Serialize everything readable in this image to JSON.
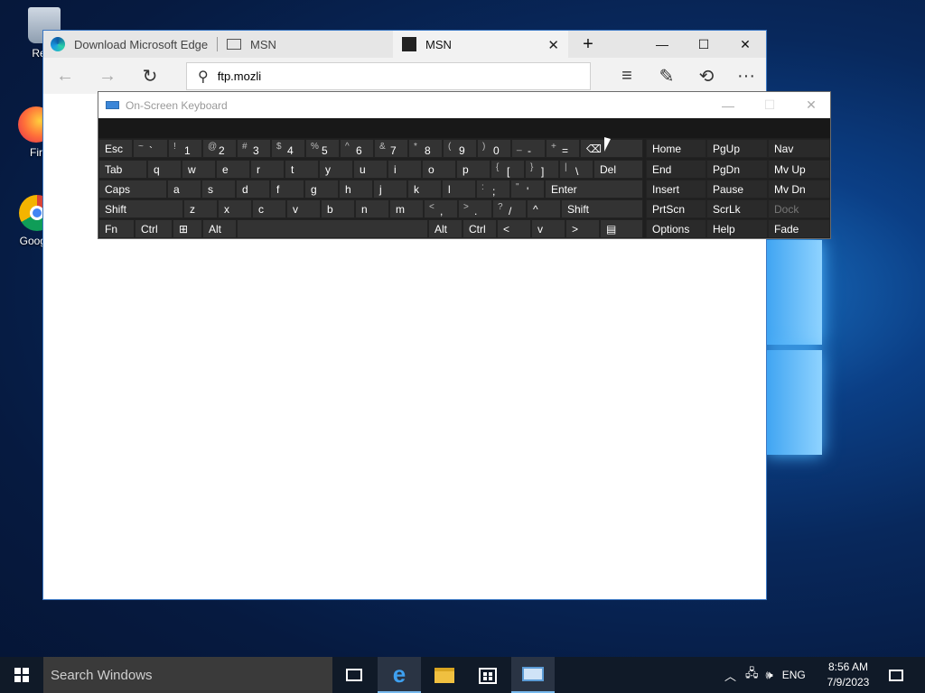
{
  "desktop": {
    "icons": [
      {
        "label": "Recy",
        "icon": "recycle-bin-icon"
      },
      {
        "label": "Fir",
        "icon": "firefox-icon"
      },
      {
        "label": "Google",
        "icon": "chrome-icon"
      }
    ]
  },
  "browser": {
    "tabs": [
      {
        "label": "Download Microsoft Edge",
        "icon": "edge-icon"
      },
      {
        "label": "MSN",
        "icon": "page-icon"
      },
      {
        "label": "MSN",
        "icon": "msn-icon",
        "active": true
      }
    ],
    "new_tab": "+",
    "window_controls": {
      "minimize": "—",
      "maximize": "☐",
      "close": "✕"
    },
    "toolbar": {
      "back": "←",
      "forward": "→",
      "refresh": "↻",
      "hub": "≡",
      "notes": "✎",
      "share": "⟲",
      "more": "···"
    },
    "address": {
      "value": "ftp.mozli",
      "search_icon": "⚲"
    }
  },
  "osk": {
    "title": "On-Screen Keyboard",
    "controls": {
      "minimize": "—",
      "maximize": "☐",
      "close": "✕"
    },
    "rows": [
      [
        {
          "m": "Esc"
        },
        {
          "s": "~",
          "m": "`"
        },
        {
          "s": "!",
          "m": "1"
        },
        {
          "s": "@",
          "m": "2"
        },
        {
          "s": "#",
          "m": "3"
        },
        {
          "s": "$",
          "m": "4"
        },
        {
          "s": "%",
          "m": "5"
        },
        {
          "s": "^",
          "m": "6"
        },
        {
          "s": "&",
          "m": "7"
        },
        {
          "s": "*",
          "m": "8"
        },
        {
          "s": "(",
          "m": "9"
        },
        {
          "s": ")",
          "m": "0"
        },
        {
          "s": "_",
          "m": "-"
        },
        {
          "s": "+",
          "m": "="
        },
        {
          "m": "⌫"
        }
      ],
      [
        {
          "m": "Tab"
        },
        {
          "m": "q"
        },
        {
          "m": "w"
        },
        {
          "m": "e"
        },
        {
          "m": "r"
        },
        {
          "m": "t"
        },
        {
          "m": "y"
        },
        {
          "m": "u"
        },
        {
          "m": "i"
        },
        {
          "m": "o"
        },
        {
          "m": "p"
        },
        {
          "s": "{",
          "m": "["
        },
        {
          "s": "}",
          "m": "]"
        },
        {
          "s": "|",
          "m": "\\"
        },
        {
          "m": "Del"
        }
      ],
      [
        {
          "m": "Caps"
        },
        {
          "m": "a"
        },
        {
          "m": "s"
        },
        {
          "m": "d"
        },
        {
          "m": "f"
        },
        {
          "m": "g"
        },
        {
          "m": "h"
        },
        {
          "m": "j"
        },
        {
          "m": "k"
        },
        {
          "m": "l"
        },
        {
          "s": ":",
          "m": ";"
        },
        {
          "s": "\"",
          "m": "'"
        },
        {
          "m": "Enter"
        }
      ],
      [
        {
          "m": "Shift"
        },
        {
          "m": "z"
        },
        {
          "m": "x"
        },
        {
          "m": "c"
        },
        {
          "m": "v"
        },
        {
          "m": "b"
        },
        {
          "m": "n"
        },
        {
          "m": "m"
        },
        {
          "s": "<",
          "m": ","
        },
        {
          "s": ">",
          "m": "."
        },
        {
          "s": "?",
          "m": "/"
        },
        {
          "m": "^"
        },
        {
          "m": "Shift"
        }
      ],
      [
        {
          "m": "Fn"
        },
        {
          "m": "Ctrl"
        },
        {
          "m": "⊞"
        },
        {
          "m": "Alt"
        },
        {
          "m": ""
        },
        {
          "m": "Alt"
        },
        {
          "m": "Ctrl"
        },
        {
          "m": "<"
        },
        {
          "m": "v"
        },
        {
          "m": ">"
        },
        {
          "m": "▤"
        }
      ]
    ],
    "nav_rows": [
      [
        "Home",
        "PgUp",
        "Nav"
      ],
      [
        "End",
        "PgDn",
        "Mv Up"
      ],
      [
        "Insert",
        "Pause",
        "Mv Dn"
      ],
      [
        "PrtScn",
        "ScrLk",
        "Dock"
      ],
      [
        "Options",
        "Help",
        "Fade"
      ]
    ]
  },
  "taskbar": {
    "search_placeholder": "Search Windows",
    "apps": [
      "task-view-icon",
      "edge-icon",
      "file-explorer-icon",
      "store-icon",
      "osk-icon"
    ],
    "tray": {
      "language": "ENG"
    },
    "clock": {
      "time": "8:56 AM",
      "date": "7/9/2023"
    }
  },
  "colors": {
    "accent": "#0078d7",
    "osk_key": "#333333",
    "taskbar": "#101a28"
  }
}
